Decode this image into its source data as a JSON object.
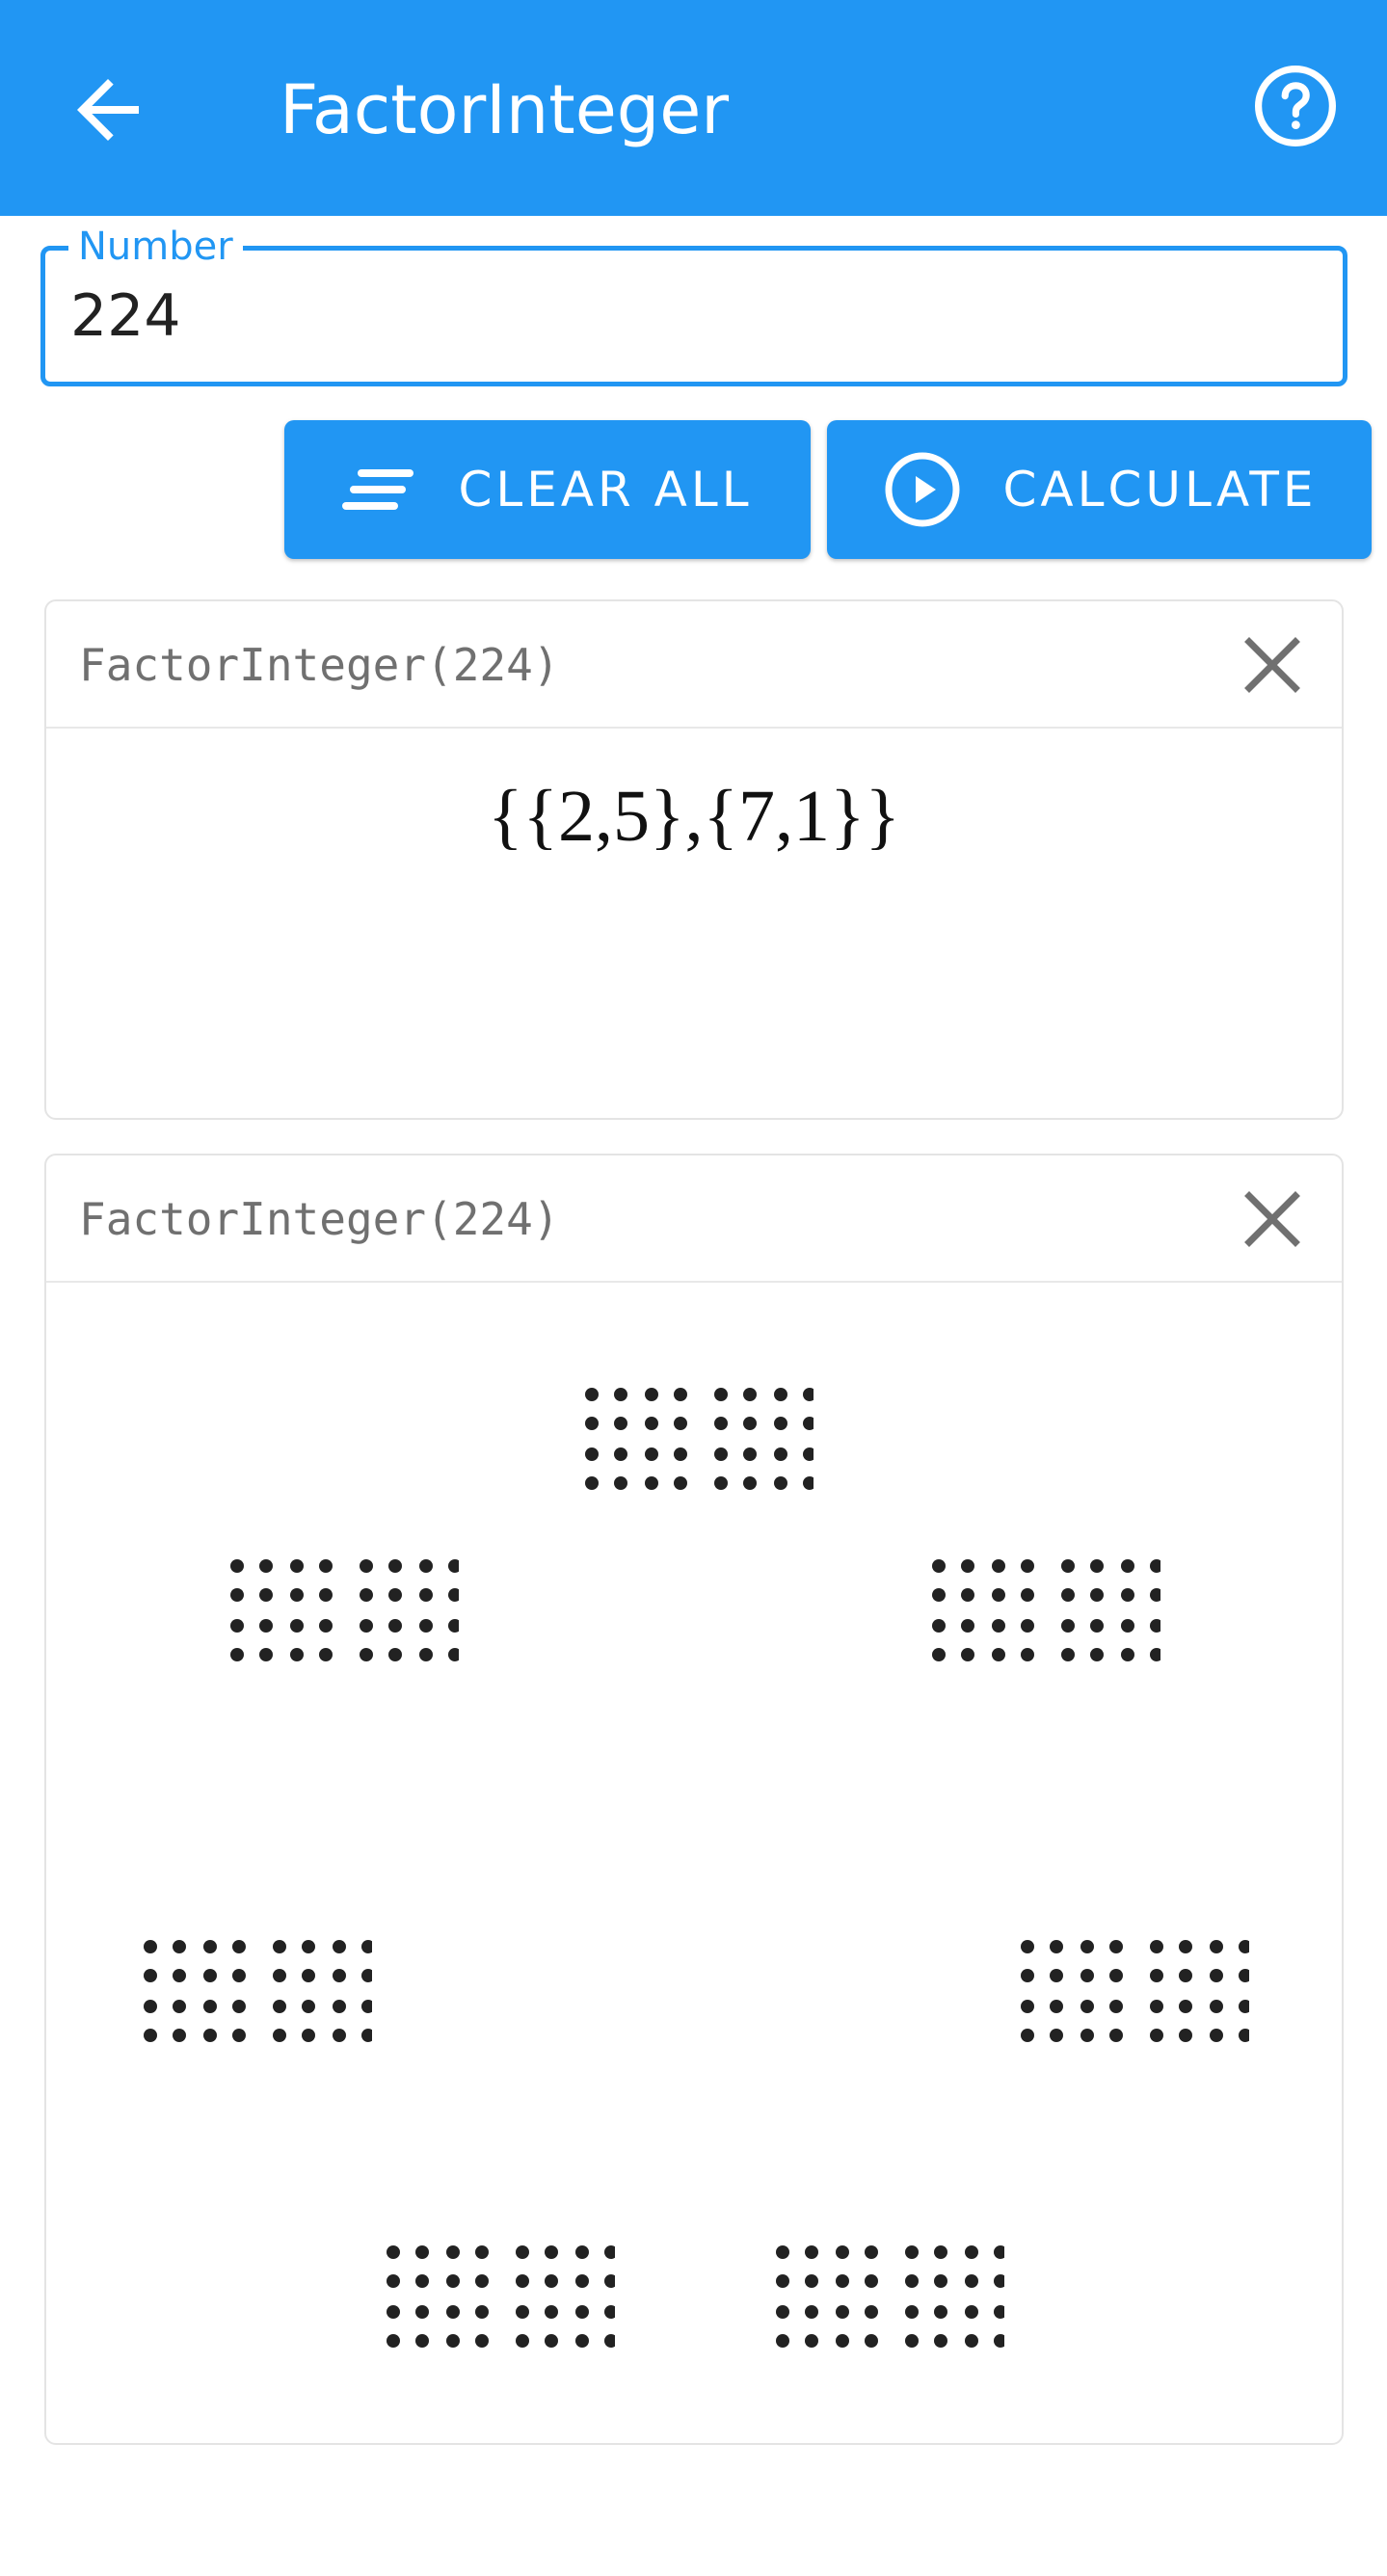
{
  "appbar": {
    "title": "FactorInteger",
    "back_icon": "arrow-left-icon",
    "help_icon": "help-circle-icon",
    "color": "#2196f3"
  },
  "input": {
    "label": "Number",
    "value": "224"
  },
  "buttons": {
    "clear_label": "CLEAR ALL",
    "calculate_label": "CALCULATE"
  },
  "cards": [
    {
      "title": "FactorInteger(224)",
      "result": "{{2,5},{7,1}}"
    },
    {
      "title": "FactorInteger(224)"
    }
  ]
}
